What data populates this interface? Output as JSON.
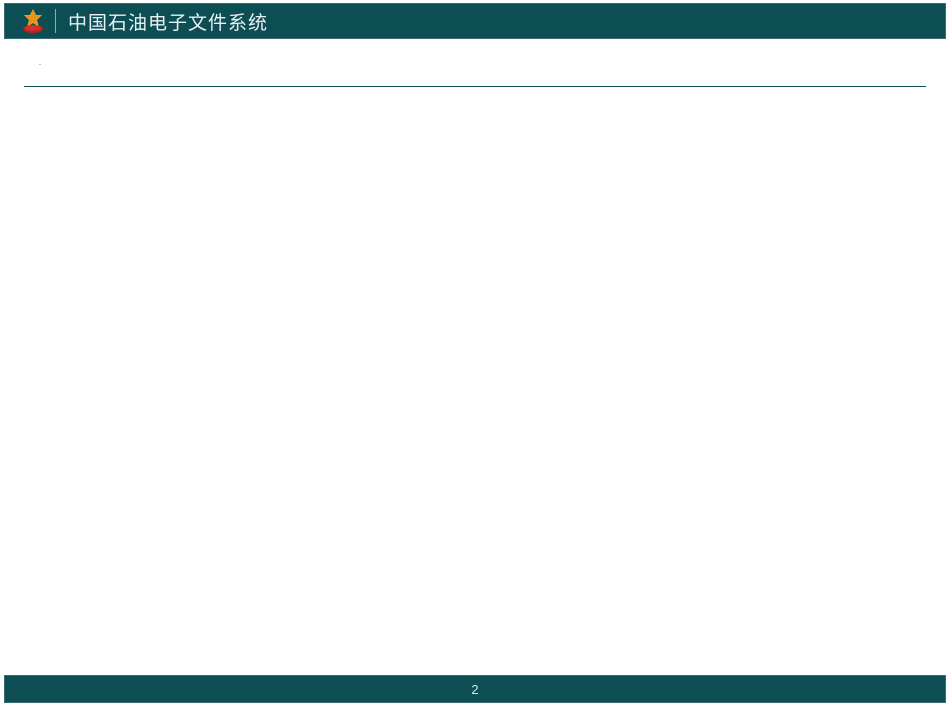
{
  "header": {
    "title": "中国石油电子文件系统"
  },
  "content": {
    "small_mark": "-"
  },
  "footer": {
    "page_number": "2"
  },
  "colors": {
    "header_bg": "#0d4e54",
    "text_light": "#e8f0f1"
  }
}
